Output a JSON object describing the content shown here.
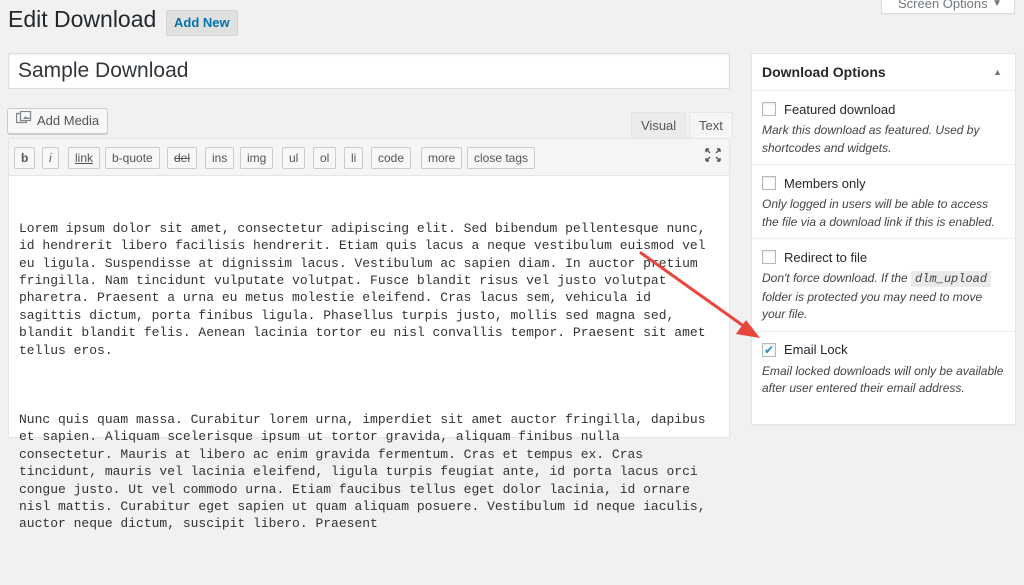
{
  "header": {
    "title": "Edit Download",
    "add_new_label": "Add New",
    "screen_options_label": "Screen Options"
  },
  "post": {
    "title_value": "Sample Download"
  },
  "editor": {
    "add_media_label": "Add Media",
    "tab_visual": "Visual",
    "tab_text": "Text",
    "quicktags": [
      "b",
      "i",
      "link",
      "b-quote",
      "del",
      "ins",
      "img",
      "ul",
      "ol",
      "li",
      "code",
      "more",
      "close tags"
    ],
    "paragraphs": [
      "Lorem ipsum dolor sit amet, consectetur adipiscing elit. Sed bibendum pellentesque nunc, id hendrerit libero facilisis hendrerit. Etiam quis lacus a neque vestibulum euismod vel eu ligula. Suspendisse at dignissim lacus. Vestibulum ac sapien diam. In auctor pretium fringilla. Nam tincidunt vulputate volutpat. Fusce blandit risus vel justo volutpat pharetra. Praesent a urna eu metus molestie eleifend. Cras lacus sem, vehicula id sagittis dictum, porta finibus ligula. Phasellus turpis justo, mollis sed magna sed, blandit blandit felis. Aenean lacinia tortor eu nisl convallis tempor. Praesent sit amet tellus eros.",
      "Nunc quis quam massa. Curabitur lorem urna, imperdiet sit amet auctor fringilla, dapibus et sapien. Aliquam scelerisque ipsum ut tortor gravida, aliquam finibus nulla consectetur. Mauris at libero ac enim gravida fermentum. Cras et tempus ex. Cras tincidunt, mauris vel lacinia eleifend, ligula turpis feugiat ante, id porta lacus orci congue justo. Ut vel commodo urna. Etiam faucibus tellus eget dolor lacinia, id ornare nisl mattis. Curabitur eget sapien ut quam aliquam posuere. Vestibulum id neque iaculis, auctor neque dictum, suscipit libero. Praesent"
    ]
  },
  "download_options": {
    "title": "Download Options",
    "options": [
      {
        "label": "Featured download",
        "checked": false,
        "description": "Mark this download as featured. Used by shortcodes and widgets."
      },
      {
        "label": "Members only",
        "checked": false,
        "description": "Only logged in users will be able to access the file via a download link if this is enabled."
      },
      {
        "label": "Redirect to file",
        "checked": false,
        "description_before": "Don't force download. If the ",
        "description_code": "dlm_upload",
        "description_after": " folder is protected you may need to move your file."
      },
      {
        "label": "Email Lock",
        "checked": true,
        "check_glyph": "✔",
        "description": "Email locked downloads will only be available after user entered their email address."
      }
    ]
  },
  "icons": {
    "add_media": "media-icon",
    "fullscreen": "fullscreen-icon",
    "screen_options_arrow": "triangle-down-icon",
    "box_toggle": "triangle-up-icon"
  },
  "colors": {
    "link_blue": "#0073aa",
    "annotation_red": "#e8453c",
    "checkbox_blue": "#1e8cbe"
  }
}
